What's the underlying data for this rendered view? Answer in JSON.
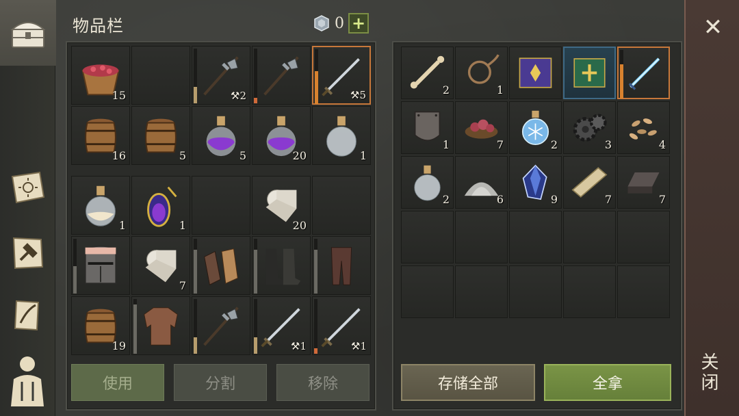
{
  "inventory": {
    "title": "物品栏",
    "currency_count": "0",
    "plus_label": "+",
    "rows_top": [
      [
        {
          "icon": "bowl-of-berries-icon",
          "qty": "15"
        },
        {
          "icon": "",
          "qty": ""
        },
        {
          "icon": "halberd-icon",
          "dur": "2",
          "bar": 0.3,
          "bar_color": "#b79d6d"
        },
        {
          "icon": "halberd-icon",
          "dur": "",
          "bar": 0.1,
          "bar_color": "#d06a3a"
        },
        {
          "icon": "sword-icon",
          "dur": "5",
          "bar": 0.6,
          "bar_color": "#d8822f",
          "selected": true
        }
      ],
      [
        {
          "icon": "barrel-icon",
          "qty": "16"
        },
        {
          "icon": "barrel-icon",
          "qty": "5"
        },
        {
          "icon": "purple-potion-icon",
          "qty": "5"
        },
        {
          "icon": "purple-potion-icon",
          "qty": "20"
        },
        {
          "icon": "empty-flask-icon",
          "qty": "1"
        }
      ]
    ],
    "rows_bottom": [
      [
        {
          "icon": "milk-flask-icon",
          "qty": "1"
        },
        {
          "icon": "amulet-flask-icon",
          "qty": "1"
        },
        {
          "icon": "",
          "qty": ""
        },
        {
          "icon": "cloth-roll-icon",
          "qty": "20"
        },
        {
          "icon": "",
          "qty": ""
        }
      ],
      [
        {
          "icon": "great-helm-icon",
          "qty": "",
          "bar": 0.5,
          "bar_color": "#6b6a63"
        },
        {
          "icon": "cloth-roll-icon",
          "qty": "7"
        },
        {
          "icon": "gloves-icon",
          "qty": "",
          "bar": 0.8,
          "bar_color": "#6b6a63"
        },
        {
          "icon": "boots-icon",
          "qty": "",
          "bar": 0.8,
          "bar_color": "#6b6a63"
        },
        {
          "icon": "leggings-icon",
          "qty": "",
          "bar": 0.8,
          "bar_color": "#6b6a63"
        }
      ],
      [
        {
          "icon": "barrel-icon",
          "qty": "19"
        },
        {
          "icon": "chainmail-icon",
          "qty": "",
          "bar": 0.9,
          "bar_color": "#6b6a63"
        },
        {
          "icon": "halberd-icon",
          "qty": "",
          "bar": 0.3,
          "bar_color": "#b79d6d"
        },
        {
          "icon": "sword-icon",
          "dur": "1",
          "bar": 0.3,
          "bar_color": "#b79d6d"
        },
        {
          "icon": "sword-icon",
          "dur": "1",
          "bar": 0.1,
          "bar_color": "#d06a3a"
        }
      ]
    ],
    "buttons": {
      "use": "使用",
      "split": "分割",
      "remove": "移除"
    }
  },
  "container": {
    "rows": [
      [
        {
          "icon": "bone-icon",
          "qty": "2"
        },
        {
          "icon": "rope-icon",
          "qty": "1"
        },
        {
          "icon": "purple-book-icon",
          "qty": ""
        },
        {
          "icon": "green-book-icon",
          "qty": "",
          "blue": true
        },
        {
          "icon": "ice-sword-icon",
          "qty": "",
          "selected": true,
          "bar": 0.7,
          "bar_color": "#d8822f"
        }
      ],
      [
        {
          "icon": "iron-plate-icon",
          "qty": "1"
        },
        {
          "icon": "meat-bowl-icon",
          "qty": "7"
        },
        {
          "icon": "frost-flask-icon",
          "qty": "2"
        },
        {
          "icon": "gear-icon",
          "qty": "3"
        },
        {
          "icon": "seeds-icon",
          "qty": "4"
        }
      ],
      [
        {
          "icon": "empty-flask-icon",
          "qty": "2"
        },
        {
          "icon": "salt-pile-icon",
          "qty": "6"
        },
        {
          "icon": "crystal-icon",
          "qty": "9"
        },
        {
          "icon": "plank-icon",
          "qty": "7"
        },
        {
          "icon": "iron-ingot-icon",
          "qty": "7"
        }
      ],
      [
        {
          "icon": "",
          "qty": ""
        },
        {
          "icon": "",
          "qty": ""
        },
        {
          "icon": "",
          "qty": ""
        },
        {
          "icon": "",
          "qty": ""
        },
        {
          "icon": "",
          "qty": ""
        }
      ],
      [
        {
          "icon": "",
          "qty": ""
        },
        {
          "icon": "",
          "qty": ""
        },
        {
          "icon": "",
          "qty": ""
        },
        {
          "icon": "",
          "qty": ""
        },
        {
          "icon": "",
          "qty": ""
        }
      ]
    ],
    "buttons": {
      "store_all": "存储全部",
      "take_all": "全拿"
    }
  },
  "close": {
    "label": "关闭",
    "x": "✕"
  },
  "sidebar": {
    "items": [
      {
        "icon": "chest-icon",
        "active": true
      },
      {
        "icon": "sun-book-icon"
      },
      {
        "icon": "craft-hammer-icon"
      },
      {
        "icon": "quest-scroll-icon"
      },
      {
        "icon": "character-icon"
      }
    ]
  }
}
